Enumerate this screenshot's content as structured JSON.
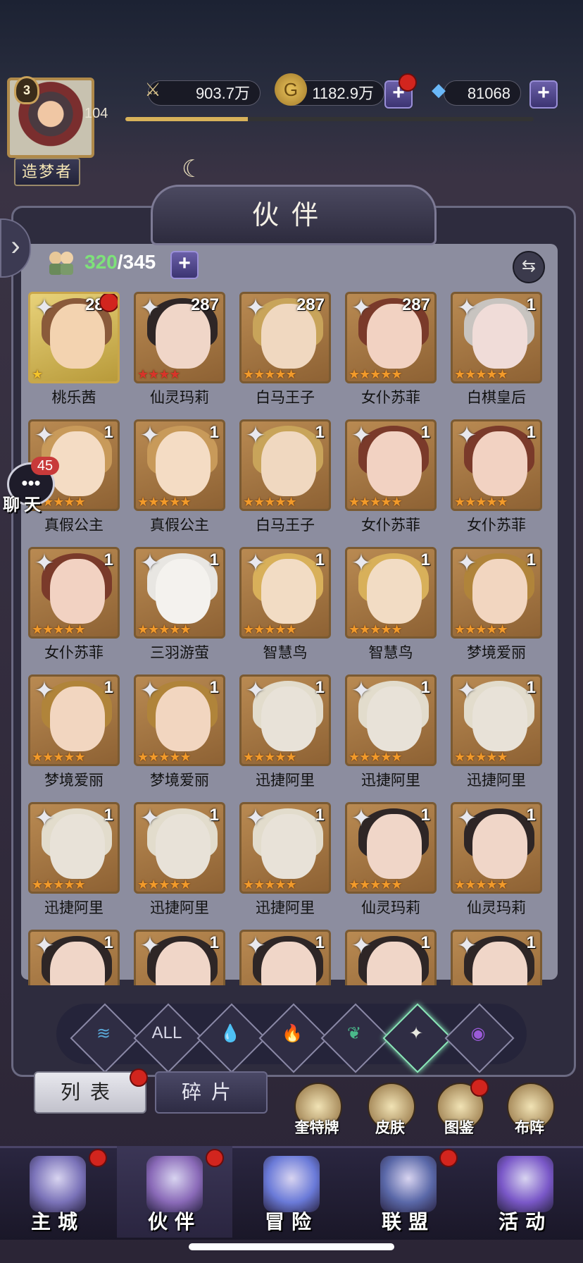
{
  "player": {
    "level": "3",
    "number": "104",
    "title": "造梦者"
  },
  "resources": {
    "power": "903.7万",
    "gold": "1182.9万",
    "diamonds": "81068"
  },
  "exp_fraction": 0.3,
  "header": {
    "title": "伙伴"
  },
  "roster": {
    "current": "320",
    "sep_max": "/345"
  },
  "cards": [
    {
      "name": "桃乐茜",
      "level": "287",
      "stars": "★",
      "style": "gold",
      "dot": true,
      "skin": "#f3d3b0",
      "hair": "#8a5a3a"
    },
    {
      "name": "仙灵玛莉",
      "level": "287",
      "stars": "★★★★",
      "style": "red",
      "skin": "#f0d6c8",
      "hair": "#2e2626"
    },
    {
      "name": "白马王子",
      "level": "287",
      "stars": "★★★★★",
      "style": "",
      "skin": "#f0d8c0",
      "hair": "#c8a45a"
    },
    {
      "name": "女仆苏菲",
      "level": "287",
      "stars": "★★★★★",
      "style": "",
      "skin": "#f2d2c2",
      "hair": "#7a3a2a"
    },
    {
      "name": "白棋皇后",
      "level": "1",
      "stars": "★★★★★",
      "style": "",
      "skin": "#f0dcd8",
      "hair": "#c8c4c0"
    },
    {
      "name": "真假公主",
      "level": "1",
      "stars": "★★★★★",
      "style": "",
      "skin": "#f4dcc4",
      "hair": "#c89a5a"
    },
    {
      "name": "真假公主",
      "level": "1",
      "stars": "★★★★★",
      "style": "",
      "skin": "#f4dcc4",
      "hair": "#c89a5a"
    },
    {
      "name": "白马王子",
      "level": "1",
      "stars": "★★★★★",
      "style": "",
      "skin": "#f0d8c0",
      "hair": "#c8a45a"
    },
    {
      "name": "女仆苏菲",
      "level": "1",
      "stars": "★★★★★",
      "style": "",
      "skin": "#f2d2c2",
      "hair": "#7a3a2a"
    },
    {
      "name": "女仆苏菲",
      "level": "1",
      "stars": "★★★★★",
      "style": "",
      "skin": "#f2d2c2",
      "hair": "#7a3a2a"
    },
    {
      "name": "女仆苏菲",
      "level": "1",
      "stars": "★★★★★",
      "style": "",
      "skin": "#f2d2c2",
      "hair": "#7a3a2a"
    },
    {
      "name": "三羽游萤",
      "level": "1",
      "stars": "★★★★★",
      "style": "",
      "skin": "#f4f2ee",
      "hair": "#e8e6e2"
    },
    {
      "name": "智慧鸟",
      "level": "1",
      "stars": "★★★★★",
      "style": "",
      "skin": "#f2dcc4",
      "hair": "#d8b05a"
    },
    {
      "name": "智慧鸟",
      "level": "1",
      "stars": "★★★★★",
      "style": "",
      "skin": "#f2dcc4",
      "hair": "#d8b05a"
    },
    {
      "name": "梦境爱丽",
      "level": "1",
      "stars": "★★★★★",
      "style": "",
      "skin": "#f2d6c0",
      "hair": "#b0843a"
    },
    {
      "name": "梦境爱丽",
      "level": "1",
      "stars": "★★★★★",
      "style": "",
      "skin": "#f2d6c0",
      "hair": "#b0843a"
    },
    {
      "name": "梦境爱丽",
      "level": "1",
      "stars": "★★★★★",
      "style": "",
      "skin": "#f2d6c0",
      "hair": "#b0843a"
    },
    {
      "name": "迅捷阿里",
      "level": "1",
      "stars": "★★★★★",
      "style": "",
      "skin": "#e8e2d8",
      "hair": "#e2dccc"
    },
    {
      "name": "迅捷阿里",
      "level": "1",
      "stars": "★★★★★",
      "style": "",
      "skin": "#e8e2d8",
      "hair": "#e2dccc"
    },
    {
      "name": "迅捷阿里",
      "level": "1",
      "stars": "★★★★★",
      "style": "",
      "skin": "#e8e2d8",
      "hair": "#e2dccc"
    },
    {
      "name": "迅捷阿里",
      "level": "1",
      "stars": "★★★★★",
      "style": "",
      "skin": "#e8e2d8",
      "hair": "#e2dccc"
    },
    {
      "name": "迅捷阿里",
      "level": "1",
      "stars": "★★★★★",
      "style": "",
      "skin": "#e8e2d8",
      "hair": "#e2dccc"
    },
    {
      "name": "迅捷阿里",
      "level": "1",
      "stars": "★★★★★",
      "style": "",
      "skin": "#e8e2d8",
      "hair": "#e2dccc"
    },
    {
      "name": "仙灵玛莉",
      "level": "1",
      "stars": "★★★★★",
      "style": "",
      "skin": "#f0d6c8",
      "hair": "#2e2626"
    },
    {
      "name": "仙灵玛莉",
      "level": "1",
      "stars": "★★★★★",
      "style": "",
      "skin": "#f0d6c8",
      "hair": "#2e2626"
    },
    {
      "name": "",
      "level": "1",
      "stars": "",
      "style": "",
      "skin": "#f0d6c8",
      "hair": "#2e2626"
    },
    {
      "name": "",
      "level": "1",
      "stars": "",
      "style": "",
      "skin": "#f0d6c8",
      "hair": "#2e2626"
    },
    {
      "name": "",
      "level": "1",
      "stars": "",
      "style": "",
      "skin": "#f0d6c8",
      "hair": "#2e2626"
    },
    {
      "name": "",
      "level": "1",
      "stars": "",
      "style": "",
      "skin": "#f0d6c8",
      "hair": "#2e2626"
    },
    {
      "name": "",
      "level": "1",
      "stars": "",
      "style": "",
      "skin": "#f0d6c8",
      "hair": "#2e2626"
    }
  ],
  "elements": [
    {
      "label": "",
      "icon": "wind-element-icon",
      "color": "#5aa8d8"
    },
    {
      "label": "ALL",
      "icon": "all-element-icon",
      "color": "#d8d8e8"
    },
    {
      "label": "",
      "icon": "water-element-icon",
      "color": "#4a9ad8"
    },
    {
      "label": "",
      "icon": "fire-element-icon",
      "color": "#d8503a"
    },
    {
      "label": "",
      "icon": "nature-element-icon",
      "color": "#4ab88a"
    },
    {
      "label": "",
      "icon": "light-element-icon",
      "color": "#e8e8e0"
    },
    {
      "label": "",
      "icon": "dark-element-icon",
      "color": "#9a5ad8"
    }
  ],
  "chat": {
    "count": "45",
    "label": "聊天"
  },
  "tabs": {
    "list": "列表",
    "fragments": "碎片"
  },
  "functions": [
    {
      "label": "奎特牌",
      "icon": "tarot-card-icon",
      "dot": false
    },
    {
      "label": "皮肤",
      "icon": "skin-outfit-icon",
      "dot": false
    },
    {
      "label": "图鉴",
      "icon": "codex-icon",
      "dot": true
    },
    {
      "label": "布阵",
      "icon": "formation-chess-icon",
      "dot": false
    }
  ],
  "nav": [
    {
      "label": "主城",
      "icon": "castle-icon",
      "dot": true,
      "color": "#7a72b8"
    },
    {
      "label": "伙伴",
      "icon": "witch-hat-icon",
      "dot": true,
      "color": "#8a6ab8"
    },
    {
      "label": "冒险",
      "icon": "portal-icon",
      "dot": false,
      "color": "#6a7ad8"
    },
    {
      "label": "联盟",
      "icon": "shield-icon",
      "dot": true,
      "color": "#5a68a8"
    },
    {
      "label": "活动",
      "icon": "cards-icon",
      "dot": false,
      "color": "#7a58c8"
    }
  ]
}
